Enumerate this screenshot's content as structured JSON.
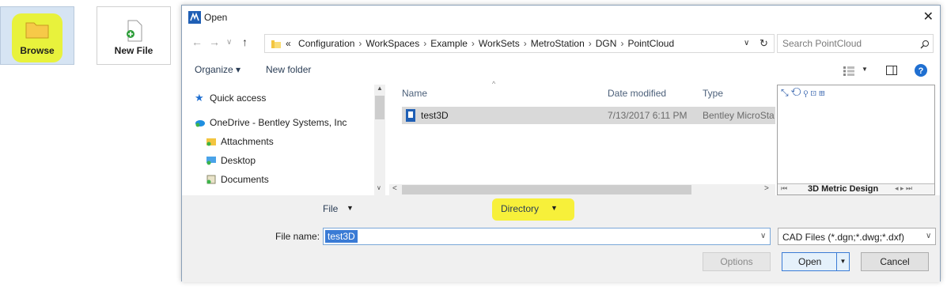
{
  "tiles": {
    "browse_label": "Browse",
    "newfile_label": "New File"
  },
  "dialog": {
    "title": "Open",
    "close_glyph": "✕",
    "address": {
      "overflow": "«",
      "crumbs": [
        "Configuration",
        "WorkSpaces",
        "Example",
        "WorkSets",
        "MetroStation",
        "DGN",
        "PointCloud"
      ]
    },
    "search_placeholder": "Search PointCloud",
    "toolbar": {
      "organize_label": "Organize ▾",
      "newfolder_label": "New folder"
    },
    "nav": {
      "items": [
        {
          "label": "Quick access",
          "icon": "star-icon"
        },
        {
          "label": "OneDrive - Bentley Systems, Inc",
          "icon": "onedrive-icon"
        },
        {
          "label": "Attachments",
          "icon": "folder-icon"
        },
        {
          "label": "Desktop",
          "icon": "desktop-icon"
        },
        {
          "label": "Documents",
          "icon": "documents-icon"
        }
      ]
    },
    "columns": {
      "name": "Name",
      "date": "Date modified",
      "type": "Type"
    },
    "files": [
      {
        "name": "test3D",
        "date": "7/13/2017 6:11 PM",
        "type": "Bentley MicroSta"
      }
    ],
    "preview": {
      "tab_label": "3D Metric Design"
    },
    "bottom": {
      "file_menu": "File",
      "directory_menu": "Directory",
      "filename_label": "File name:",
      "filename_value": "test3D",
      "filter_value": "CAD Files (*.dgn;*.dwg;*.dxf)",
      "options_label": "Options",
      "open_label": "Open",
      "cancel_label": "Cancel"
    }
  },
  "colors": {
    "highlight": "#f7f03a",
    "accent": "#3a7bd5"
  }
}
